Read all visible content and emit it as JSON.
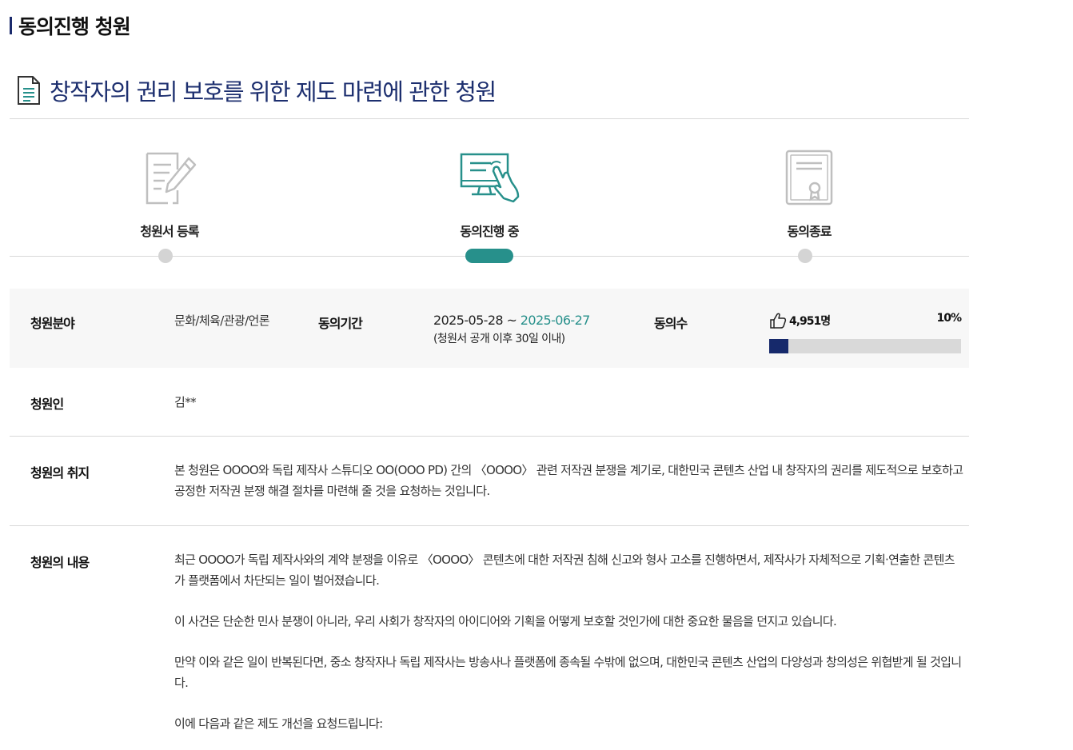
{
  "header": {
    "section_title": "동의진행 청원"
  },
  "petition": {
    "title": "창작자의 권리 보호를 위한 제도 마련에 관한 청원"
  },
  "steps": [
    {
      "label": "청원서 등록",
      "icon": "form-edit-icon",
      "status": "done"
    },
    {
      "label": "동의진행 중",
      "icon": "monitor-touch-icon",
      "status": "active"
    },
    {
      "label": "동의종료",
      "icon": "certificate-icon",
      "status": "pending"
    }
  ],
  "info": {
    "field_label": "청원분야",
    "field_value": "문화/체육/관광/언론",
    "period_label": "동의기간",
    "period_start": "2025-05-28",
    "period_sep": " ~ ",
    "period_end": "2025-06-27",
    "period_note": "(청원서 공개 이후 30일 이내)",
    "votes_label": "동의수",
    "votes_count": "4,951명",
    "votes_percent_text": "10%",
    "votes_percent": 10,
    "petitioner_label": "청원인",
    "petitioner_value": "김**"
  },
  "purpose": {
    "label": "청원의 취지",
    "text": "본 청원은 OOOO와 독립 제작사 스튜디오 OO(OOO PD) 간의 〈OOOO〉 관련 저작권 분쟁을 계기로, 대한민국 콘텐츠 산업 내 창작자의 권리를 제도적으로 보호하고 공정한 저작권 분쟁 해결 절차를 마련해 줄 것을 요청하는 것입니다."
  },
  "content": {
    "label": "청원의 내용",
    "paragraphs": [
      "최근 OOOO가 독립 제작사와의 계약 분쟁을 이유로 〈OOOO〉 콘텐츠에 대한 저작권 침해 신고와 형사 고소를 진행하면서, 제작사가 자체적으로 기획·연출한 콘텐츠가 플랫폼에서 차단되는 일이 벌어졌습니다.",
      "이 사건은 단순한 민사 분쟁이 아니라, 우리 사회가 창작자의 아이디어와 기획을 어떻게 보호할 것인가에 대한 중요한 물음을 던지고 있습니다.",
      "만약 이와 같은 일이 반복된다면, 중소 창작자나 독립 제작사는 방송사나 플랫폼에 종속될 수밖에 없으며, 대한민국 콘텐츠 산업의 다양성과 창의성은 위협받게 될 것입니다.",
      "이에 다음과 같은 제도 개선을 요청드립니다:"
    ]
  },
  "colors": {
    "title": "#1d2f6f",
    "accent": "#27908b",
    "progress": "#16296b"
  }
}
